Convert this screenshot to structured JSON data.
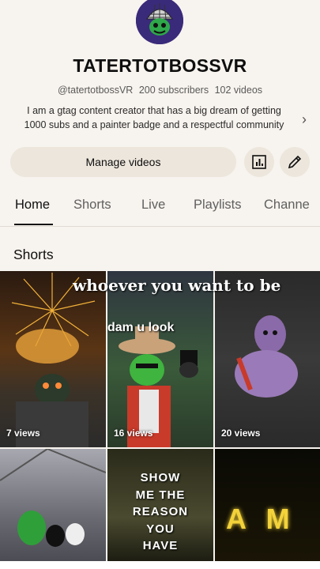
{
  "channel": {
    "name": "TATERTOTBOSSVR",
    "handle": "@tatertotbossVR",
    "subscribers": "200 subscribers",
    "videos": "102 videos",
    "description": "I am a gtag content creator that has a big dream of getting 1000 subs and a painter badge and a respectful community"
  },
  "actions": {
    "manage_label": "Manage videos",
    "analytics_icon": "analytics-icon",
    "edit_icon": "pencil-icon"
  },
  "tabs": [
    {
      "label": "Home",
      "active": true
    },
    {
      "label": "Shorts"
    },
    {
      "label": "Live"
    },
    {
      "label": "Playlists"
    },
    {
      "label": "Channe"
    }
  ],
  "shorts_section": {
    "title": "Shorts",
    "items": [
      {
        "views": "7 views",
        "overlay": "",
        "colors": [
          "#3b2a1a",
          "#c9882a"
        ]
      },
      {
        "views": "16 views",
        "overlay": "",
        "colors": [
          "#1f3a2a",
          "#7fc04a"
        ]
      },
      {
        "views": "20 views",
        "overlay": "",
        "colors": [
          "#2b2b2b",
          "#7a5fa0"
        ]
      },
      {
        "views": "",
        "overlay": "",
        "colors": [
          "#8e8e9a",
          "#2f8f3a"
        ]
      },
      {
        "views": "",
        "overlay": "SHOW ME THE REASON YOU HAVE",
        "colors": [
          "#3a3520",
          "#1a1a10"
        ]
      },
      {
        "views": "",
        "overlay": "A M",
        "colors": [
          "#0a0a05",
          "#1f1a05"
        ]
      }
    ],
    "banner_text": "whoever you want to be",
    "caption_text": "dam u look"
  }
}
